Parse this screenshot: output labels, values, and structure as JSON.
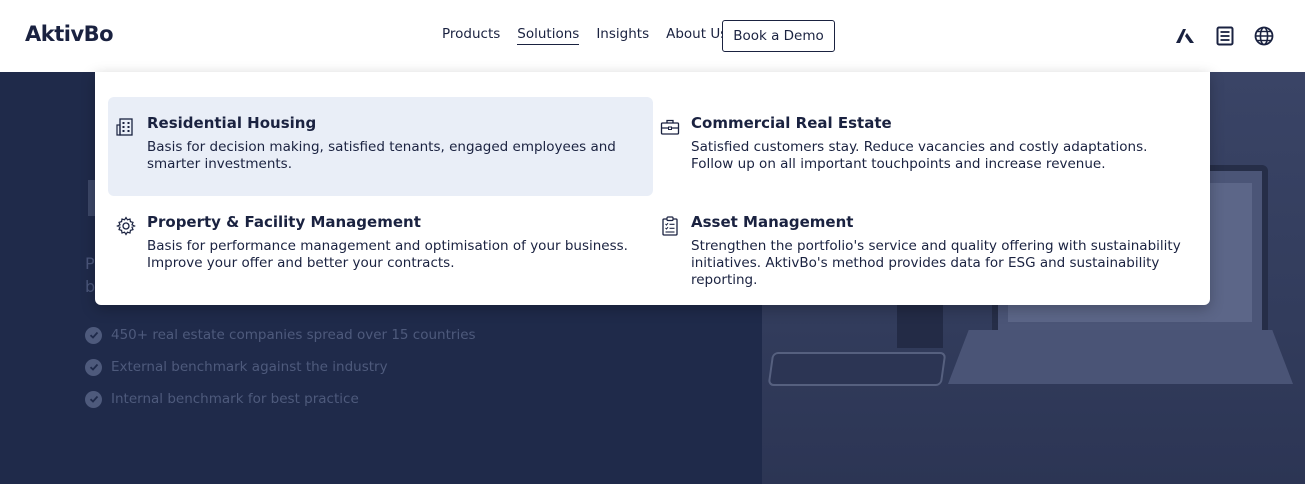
{
  "header": {
    "logo": "AktivBo",
    "nav": [
      {
        "label": "Products"
      },
      {
        "label": "Solutions"
      },
      {
        "label": "Insights"
      },
      {
        "label": "About Us"
      }
    ],
    "demo_button": "Book a Demo",
    "icons": [
      "aktivbo-brand-icon",
      "document-list-icon",
      "globe-icon"
    ]
  },
  "dropdown": {
    "items": [
      {
        "icon": "building-icon",
        "title": "Residential Housing",
        "desc": "Basis for decision making, satisfied tenants, engaged employees and smarter investments."
      },
      {
        "icon": "briefcase-icon",
        "title": "Commercial Real Estate",
        "desc": "Satisfied customers stay. Reduce vacancies and costly adaptations. Follow up on all important touchpoints and increase revenue."
      },
      {
        "icon": "gear-icon",
        "title": "Property & Facility Management",
        "desc": "Basis for performance management and optimisation of your business. Improve your offer and better your contracts."
      },
      {
        "icon": "clipboard-icon",
        "title": "Asset Management",
        "desc": "Strengthen the portfolio's service and quality offering with sustainability initiatives. AktivBo's method provides data for ESG and sustainability reporting."
      }
    ]
  },
  "hero": {
    "subtitle_line1": "P",
    "subtitle_line2": "b",
    "checks": [
      "450+ real estate companies spread over 15 countries",
      "External benchmark against the industry",
      "Internal benchmark for best practice"
    ]
  },
  "colors": {
    "navy": "#1a2240",
    "highlight": "#e9eef7",
    "hero_bg": "#1f2a4a"
  }
}
